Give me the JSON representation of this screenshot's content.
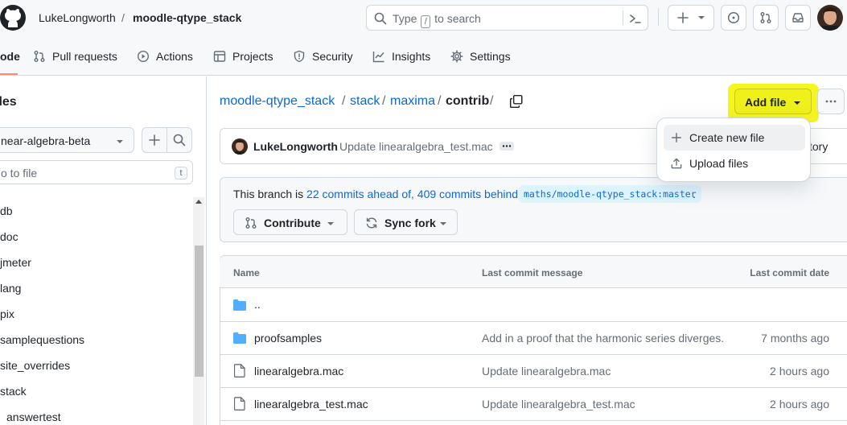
{
  "header": {
    "owner": "LukeLongworth",
    "separator": "/",
    "repo": "moodle-qtype_stack",
    "search_prefix": "Type",
    "search_key": "/",
    "search_suffix": "to search"
  },
  "nav": {
    "code": "ode",
    "pull_requests": "Pull requests",
    "actions": "Actions",
    "projects": "Projects",
    "security": "Security",
    "insights": "Insights",
    "settings": "Settings"
  },
  "sidebar": {
    "title": "iles",
    "branch": "near-algebra-beta",
    "go_to_file": "o to file",
    "go_to_file_key": "t",
    "items": [
      "db",
      "doc",
      "jmeter",
      "lang",
      "pix",
      "samplequestions",
      "site_overrides",
      "stack",
      "answertest"
    ]
  },
  "breadcrumb": {
    "parts": [
      "moodle-qtype_stack",
      "/",
      "stack",
      "/",
      "maxima",
      "/",
      "contrib",
      "/"
    ]
  },
  "add_file": {
    "label": "Add file",
    "menu": [
      "Create new file",
      "Upload files"
    ]
  },
  "commit": {
    "author": "LukeLongworth",
    "message": "Update linearalgebra_test.mac",
    "history": "tory"
  },
  "branch_status": {
    "prefix": "This branch is",
    "ahead": "22 commits ahead of,",
    "behind": "409 commits behind",
    "upstream": "maths/moodle-qtype_stack:master",
    "suffix": ".",
    "contribute": "Contribute",
    "sync_fork": "Sync fork"
  },
  "files": {
    "headers": [
      "Name",
      "Last commit message",
      "Last commit date"
    ],
    "rows": [
      {
        "name": "..",
        "message": "",
        "date": ""
      },
      {
        "name": "proofsamples",
        "message": "Add in a proof that the harmonic series diverges.",
        "date": "7 months ago"
      },
      {
        "name": "linearalgebra.mac",
        "message": "Update linearalgebra.mac",
        "date": "2 hours ago"
      },
      {
        "name": "linearalgebra_test.mac",
        "message": "Update linearalgebra_test.mac",
        "date": "2 hours ago"
      }
    ]
  },
  "colors": {
    "link": "#0969da",
    "highlight": "#f5f520",
    "folder": "#54aeff",
    "nav_underline": "#fd8c73"
  }
}
